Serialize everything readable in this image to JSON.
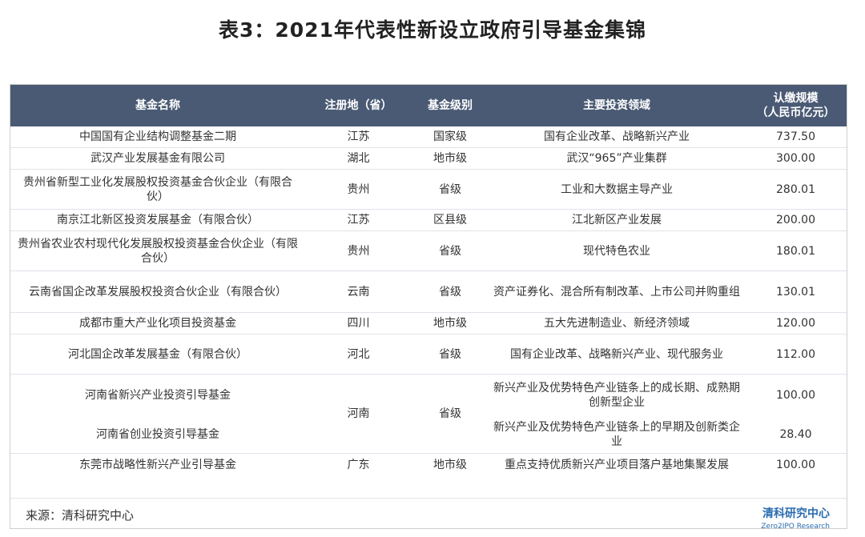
{
  "title": "表3：2021年代表性新设立政府引导基金集锦",
  "headers": {
    "name": "基金名称",
    "region": "注册地（省）",
    "level": "基金级别",
    "field": "主要投资领域",
    "scale_line1": "认缴规模",
    "scale_line2": "（人民币亿元）"
  },
  "rows": [
    {
      "name": "中国国有企业结构调整基金二期",
      "region": "江苏",
      "level": "国家级",
      "field": "国有企业改革、战略新兴产业",
      "scale": "737.50"
    },
    {
      "name": "武汉产业发展基金有限公司",
      "region": "湖北",
      "level": "地市级",
      "field": "武汉“965”产业集群",
      "scale": "300.00"
    },
    {
      "name": "贵州省新型工业化发展股权投资基金合伙企业（有限合伙）",
      "region": "贵州",
      "level": "省级",
      "field": "工业和大数据主导产业",
      "scale": "280.01"
    },
    {
      "name": "南京江北新区投资发展基金（有限合伙）",
      "region": "江苏",
      "level": "区县级",
      "field": "江北新区产业发展",
      "scale": "200.00"
    },
    {
      "name": "贵州省农业农村现代化发展股权投资基金合伙企业（有限合伙）",
      "region": "贵州",
      "level": "省级",
      "field": "现代特色农业",
      "scale": "180.01"
    },
    {
      "name": "云南省国企改革发展股权投资合伙企业（有限合伙）",
      "region": "云南",
      "level": "省级",
      "field": "资产证券化、混合所有制改革、上市公司并购重组",
      "scale": "130.01"
    },
    {
      "name": "成都市重大产业化项目投资基金",
      "region": "四川",
      "level": "地市级",
      "field": "五大先进制造业、新经济领域",
      "scale": "120.00"
    },
    {
      "name": "河北国企改革发展基金（有限合伙）",
      "region": "河北",
      "level": "省级",
      "field": "国有企业改革、战略新兴产业、现代服务业",
      "scale": "112.00"
    },
    {
      "name": "河南省新兴产业投资引导基金",
      "region": "河南",
      "level": "省级",
      "field": "新兴产业及优势特色产业链条上的成长期、成熟期创新型企业",
      "scale": "100.00"
    },
    {
      "name": "河南省创业投资引导基金",
      "region": "",
      "level": "",
      "field": "新兴产业及优势特色产业链条上的早期及创新类企业",
      "scale": "28.40"
    },
    {
      "name": "东莞市战略性新兴产业引导基金",
      "region": "广东",
      "level": "地市级",
      "field": "重点支持优质新兴产业项目落户基地集聚发展",
      "scale": "100.00"
    }
  ],
  "source": "来源：清科研究中心",
  "logo": {
    "cn": "清科研究中心",
    "en": "Zero2IPO Research"
  }
}
